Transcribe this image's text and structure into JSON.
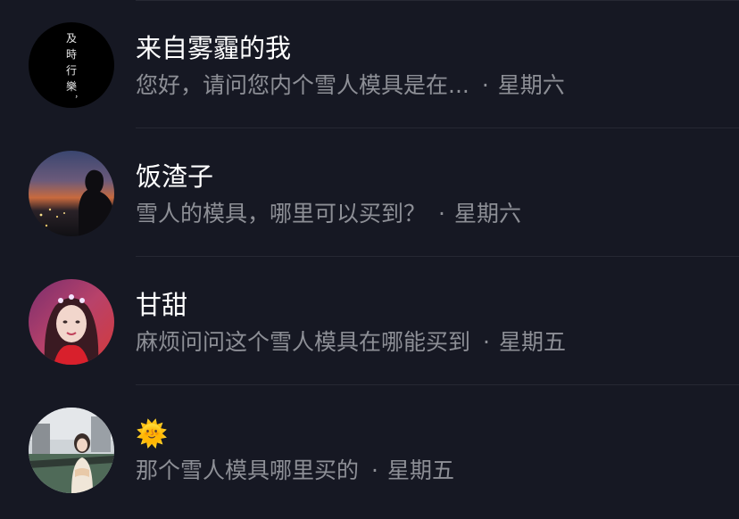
{
  "conversations": [
    {
      "name": "来自雾霾的我",
      "preview": "您好，请问您内个雪人模具是在...",
      "separator": "·",
      "time": "星期六",
      "avatar_icon": "calligraphy-avatar-icon",
      "avatar_text": [
        "及",
        "時",
        "行",
        "樂",
        "，"
      ]
    },
    {
      "name": "饭渣子",
      "preview": "雪人的模具，哪里可以买到？",
      "separator": "·",
      "time": "星期六",
      "avatar_icon": "sunset-silhouette-avatar-icon"
    },
    {
      "name": "甘甜",
      "preview": "麻烦问问这个雪人模具在哪能买到",
      "separator": "·",
      "time": "星期五",
      "avatar_icon": "portrait-avatar-icon"
    },
    {
      "name": "🌞",
      "preview": "那个雪人模具哪里买的",
      "separator": "·",
      "time": "星期五",
      "avatar_icon": "outdoor-photo-avatar-icon"
    }
  ],
  "colors": {
    "background": "#161823",
    "name": "#ffffff",
    "preview": "#8d8f96",
    "divider": "#262833"
  }
}
